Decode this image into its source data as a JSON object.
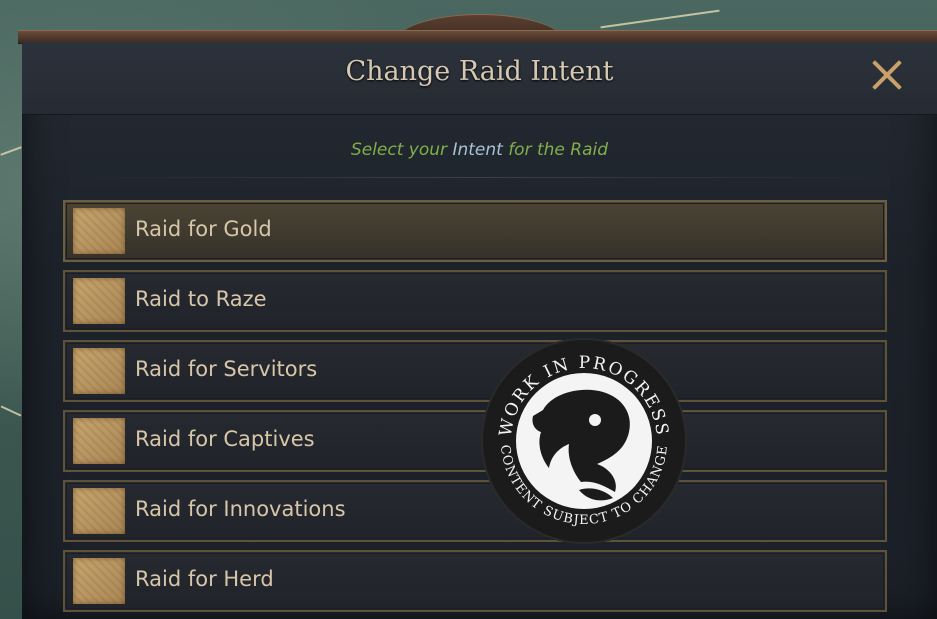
{
  "dialog": {
    "title": "Change Raid Intent",
    "close_icon": "close-icon",
    "subtitle_parts": [
      "Select your ",
      "Intent",
      " for the Raid"
    ]
  },
  "options": [
    {
      "label": "Raid for Gold",
      "selected": true,
      "icon": "scroll-icon"
    },
    {
      "label": "Raid to Raze",
      "selected": false,
      "icon": "scroll-icon"
    },
    {
      "label": "Raid for Servitors",
      "selected": false,
      "icon": "scroll-icon"
    },
    {
      "label": "Raid for Captives",
      "selected": false,
      "icon": "scroll-icon"
    },
    {
      "label": "Raid for Innovations",
      "selected": false,
      "icon": "scroll-icon"
    },
    {
      "label": "Raid for Herd",
      "selected": false,
      "icon": "scroll-icon"
    }
  ],
  "stamp": {
    "top_text": "WORK IN PROGRESS",
    "bottom_text": "CONTENT SUBJECT TO CHANGE"
  },
  "colors": {
    "accent_green": "#7fb04a",
    "accent_blue": "#a9c2d4",
    "close_gold": "#c9a06a"
  }
}
